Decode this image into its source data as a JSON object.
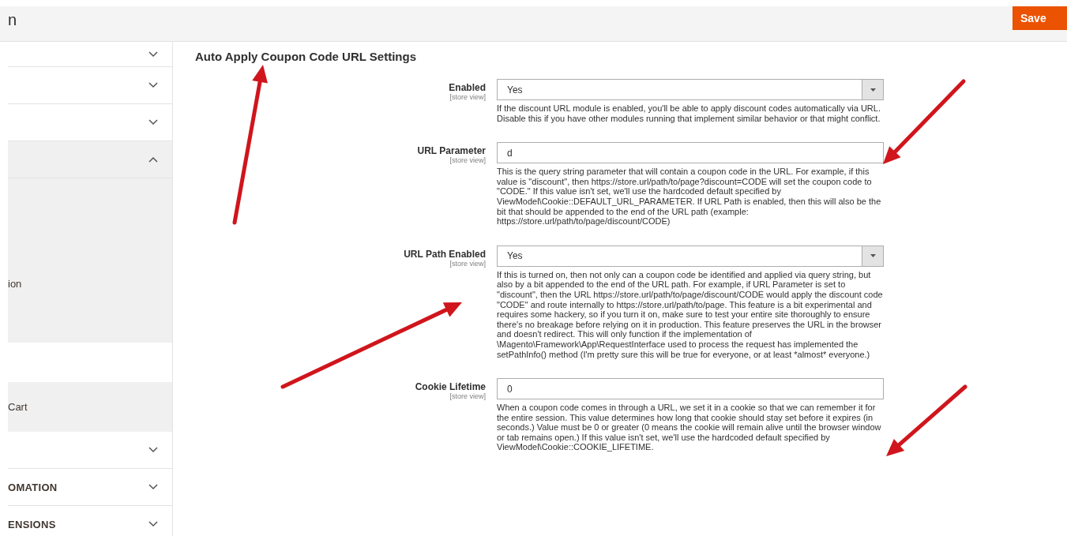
{
  "header": {
    "title": "n",
    "save_button": "Save"
  },
  "sidebar": {
    "items": [
      {
        "kind": "section",
        "expanded": false
      },
      {
        "kind": "section",
        "expanded": false
      },
      {
        "kind": "section",
        "expanded": false
      },
      {
        "kind": "section",
        "expanded": true,
        "children": [
          {
            "label": "ion"
          },
          {
            "label": "Cart"
          }
        ]
      },
      {
        "kind": "section",
        "expanded": false
      },
      {
        "kind": "section",
        "expanded": false,
        "label": "OMATION"
      },
      {
        "kind": "section",
        "expanded": false,
        "label": "ENSIONS"
      }
    ]
  },
  "section_title": "Auto Apply Coupon Code URL Settings",
  "fields": [
    {
      "kind": "select",
      "label": "Enabled",
      "scope": "[store view]",
      "value": "Yes",
      "help": "If the discount URL module is enabled, you'll be able to apply discount codes automatically via URL. Disable this if you have other modules running that implement similar behavior or that might conflict."
    },
    {
      "kind": "text",
      "label": "URL Parameter",
      "scope": "[store view]",
      "value": "d",
      "help": "This is the query string parameter that will contain a coupon code in the URL. For example, if this value is \"discount\", then https://store.url/path/to/page?discount=CODE will set the coupon code to \"CODE.\" If this value isn't set, we'll use the hardcoded default specified by ViewModel\\Cookie::DEFAULT_URL_PARAMETER. If URL Path is enabled, then this will also be the bit that should be appended to the end of the URL path (example: https://store.url/path/to/page/discount/CODE)"
    },
    {
      "kind": "select",
      "label": "URL Path Enabled",
      "scope": "[store view]",
      "value": "Yes",
      "help": "If this is turned on, then not only can a coupon code be identified and applied via query string, but also by a bit appended to the end of the URL path. For example, if URL Parameter is set to \"discount\", then the URL https://store.url/path/to/page/discount/CODE would apply the discount code \"CODE\" and route internally to https://store.url/path/to/page. This feature is a bit experimental and requires some hackery, so if you turn it on, make sure to test your entire site thoroughly to ensure there's no breakage before relying on it in production. This feature preserves the URL in the browser and doesn't redirect. This will only function if the implementation of \\Magento\\Framework\\App\\RequestInterface used to process the request has implemented the setPathInfo() method (I'm pretty sure this will be true for everyone, or at least *almost* everyone.)"
    },
    {
      "kind": "text",
      "label": "Cookie Lifetime",
      "scope": "[store view]",
      "value": "0",
      "help": "When a coupon code comes in through a URL, we set it in a cookie so that we can remember it for the entire session. This value determines how long that cookie should stay set before it expires (in seconds.) Value must be 0 or greater (0 means the cookie will remain alive until the browser window or tab remains open.) If this value isn't set, we'll use the hardcoded default specified by ViewModel\\Cookie::COOKIE_LIFETIME."
    }
  ]
}
